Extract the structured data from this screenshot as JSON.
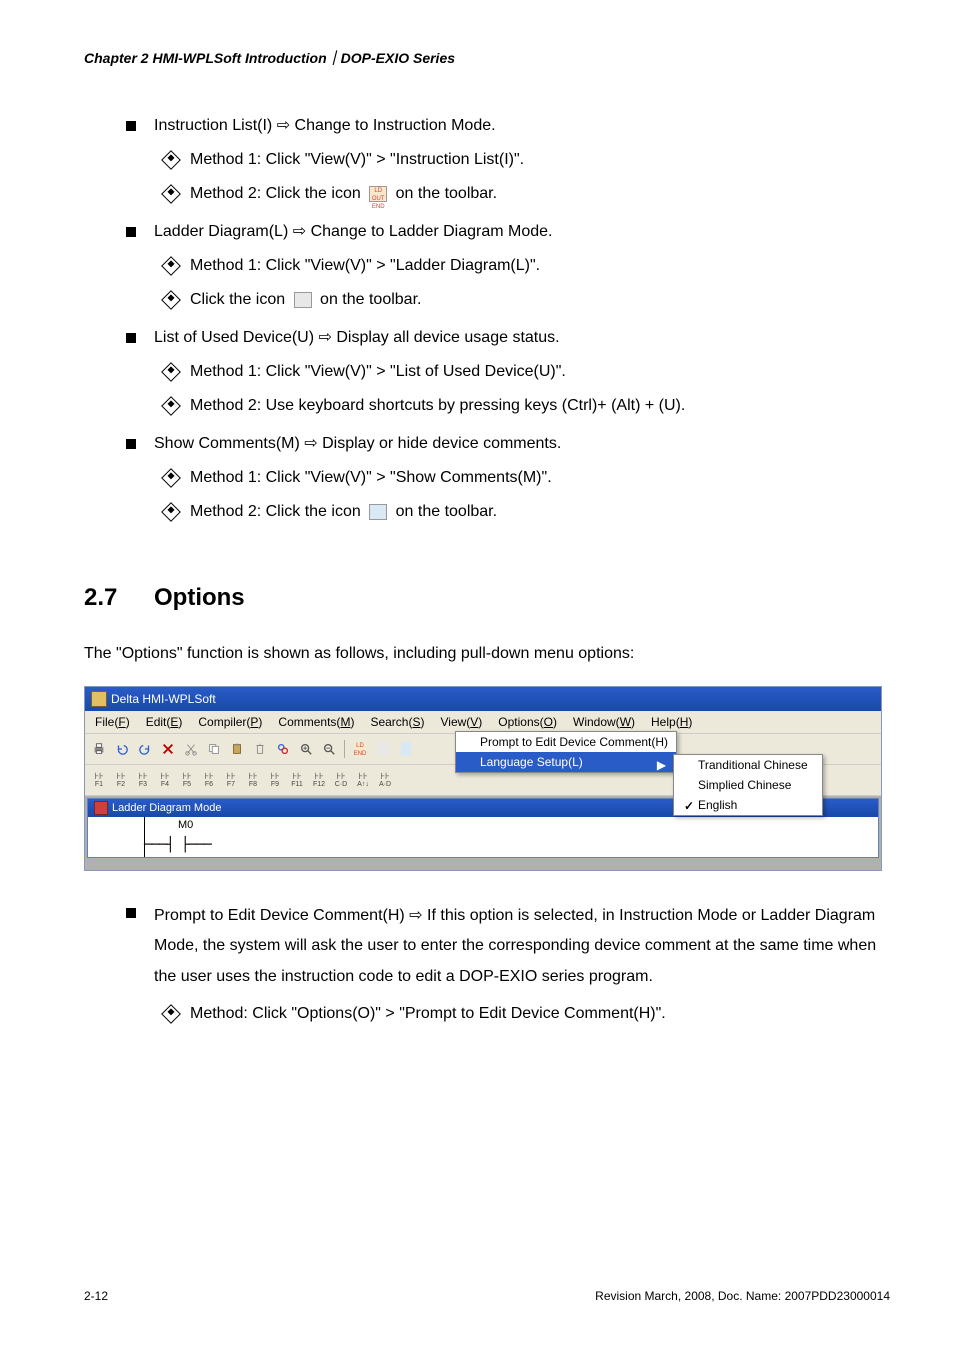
{
  "header": "Chapter 2 HMI-WPLSoft Introduction｜DOP-EXIO Series",
  "section_1": {
    "items": [
      {
        "main": "Instruction List(I) ⇨ Change to Instruction Mode.",
        "subs": [
          {
            "text": "Method 1: Click \"View(V)\" > \"Instruction List(I)\"."
          },
          {
            "pre": "Method 2: Click the icon ",
            "icon": "inst",
            "post": " on the toolbar."
          }
        ]
      },
      {
        "main": "Ladder Diagram(L) ⇨ Change to Ladder Diagram Mode.",
        "subs": [
          {
            "text": "Method 1: Click \"View(V)\" > \"Ladder Diagram(L)\"."
          },
          {
            "pre": "Click the icon ",
            "icon": "ladder",
            "post": " on the toolbar."
          }
        ]
      },
      {
        "main": "List of Used Device(U) ⇨ Display all device usage status.",
        "subs": [
          {
            "text": "Method 1: Click \"View(V)\" > \"List of Used Device(U)\"."
          },
          {
            "text": "Method 2: Use keyboard shortcuts by pressing keys (Ctrl)+ (Alt) + (U)."
          }
        ]
      },
      {
        "main": "Show Comments(M) ⇨ Display or hide device comments.",
        "subs": [
          {
            "text": "Method 1: Click \"View(V)\" > \"Show Comments(M)\"."
          },
          {
            "pre": "Method 2: Click the icon ",
            "icon": "comm",
            "post": " on the toolbar."
          }
        ]
      }
    ]
  },
  "heading": {
    "num": "2.7",
    "title": "Options"
  },
  "intro_para": "The \"Options\" function is shown as follows, including pull-down menu options:",
  "app": {
    "title": "Delta HMI-WPLSoft",
    "menus": [
      "File(F)",
      "Edit(E)",
      "Compiler(P)",
      "Comments(M)",
      "Search(S)",
      "View(V)",
      "Options(O)",
      "Window(W)",
      "Help(H)"
    ],
    "dropdown": {
      "items": [
        {
          "label": "Prompt to Edit Device Comment(H)"
        },
        {
          "label": "Language Setup(L)",
          "highlight": true,
          "has_sub": true
        }
      ]
    },
    "submenu": {
      "items": [
        {
          "label": "Tranditional Chinese"
        },
        {
          "label": "Simplied Chinese"
        },
        {
          "label": "English",
          "checked": true
        }
      ]
    },
    "toolbar2": [
      "F1",
      "F2",
      "F3",
      "F4",
      "F5",
      "F6",
      "F7",
      "F8",
      "F9",
      "F11",
      "F12",
      "C·D",
      "A↑↓",
      "A·D"
    ],
    "mdi_title": "Ladder Diagram Mode",
    "ladder_label": "M0"
  },
  "section_2": {
    "main": "Prompt to Edit Device Comment(H) ⇨ If this option is selected, in Instruction Mode or Ladder Diagram Mode, the system will ask the user to enter the corresponding device comment at the same time when the user uses the instruction code to edit a DOP-EXIO series program.",
    "sub": "Method: Click \"Options(O)\" > \"Prompt to Edit Device Comment(H)\"."
  },
  "footer": {
    "page": "2-12",
    "rev": "Revision March, 2008, Doc. Name: 2007PDD23000014"
  }
}
